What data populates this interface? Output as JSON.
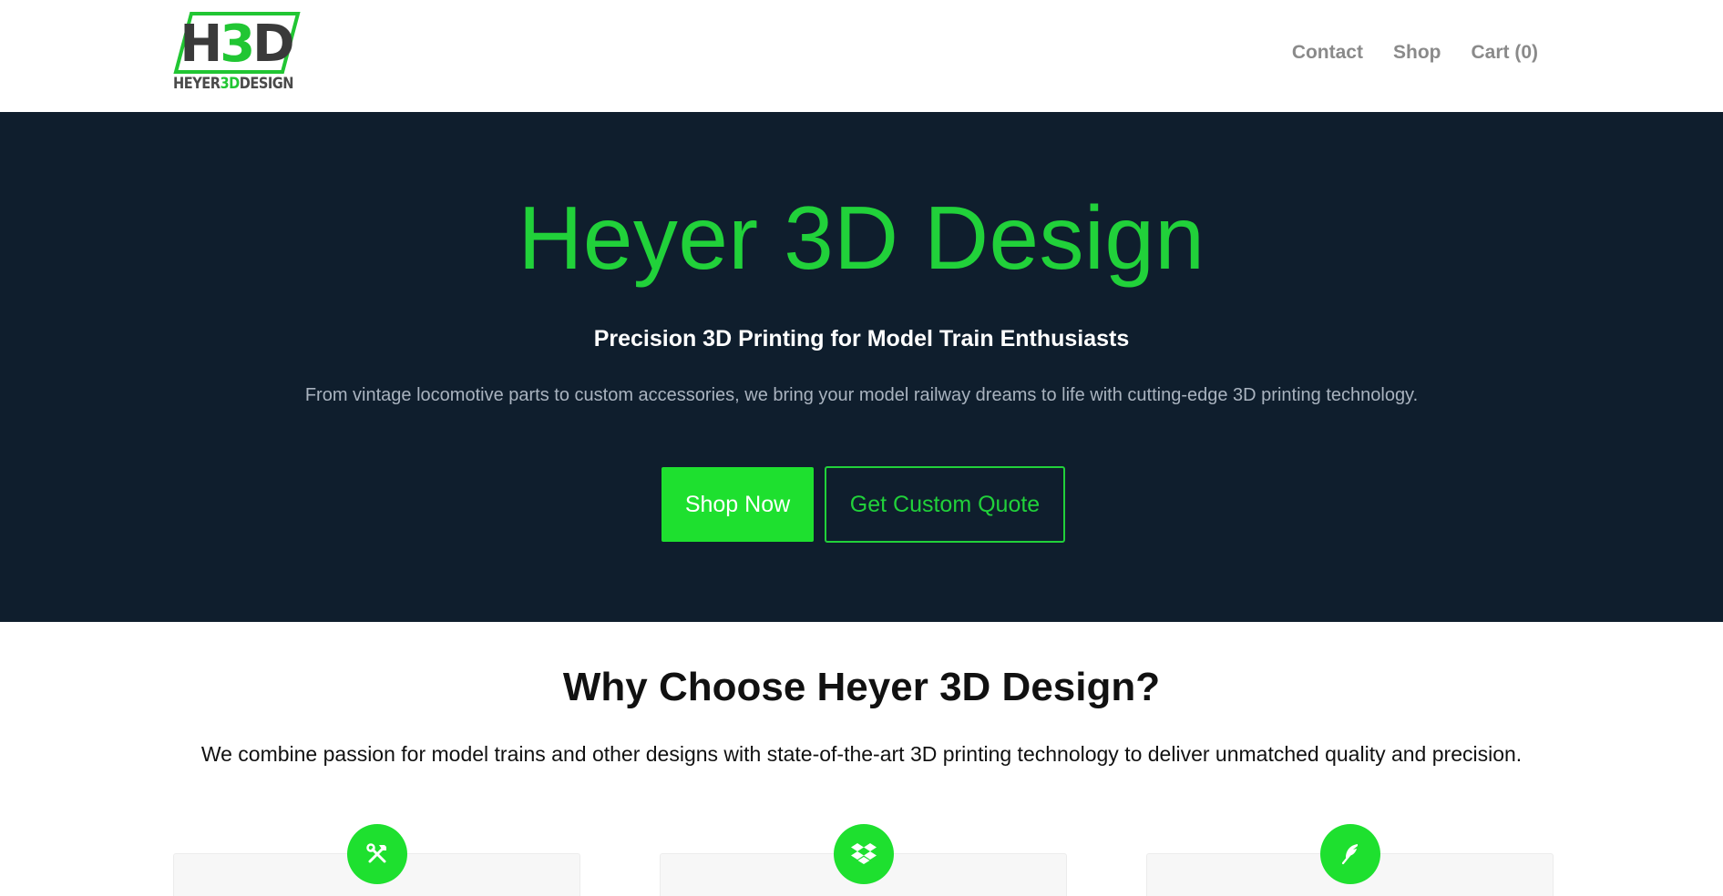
{
  "header": {
    "logo": {
      "monogram": "H3D",
      "wordmark_prefix": "HEYER",
      "wordmark_accent": "3D",
      "wordmark_suffix": "DESIGN"
    },
    "nav": [
      {
        "label": "Contact"
      },
      {
        "label": "Shop"
      },
      {
        "label": "Cart (0)"
      }
    ]
  },
  "hero": {
    "title": "Heyer 3D Design",
    "subtitle": "Precision 3D Printing for Model Train Enthusiasts",
    "description": "From vintage locomotive parts to custom accessories, we bring your model railway dreams to life with cutting-edge 3D printing technology.",
    "primary_button": "Shop Now",
    "secondary_button": "Get Custom Quote"
  },
  "features": {
    "title": "Why Choose Heyer 3D Design?",
    "description": "We combine passion for model trains and other designs with state-of-the-art 3D printing technology to deliver unmatched quality and precision.",
    "cards": [
      {
        "icon": "tools-icon"
      },
      {
        "icon": "dropbox-icon"
      },
      {
        "icon": "feather-icon"
      }
    ]
  },
  "colors": {
    "accent": "#1ee02f",
    "hero_background": "#0f1e2d",
    "nav_text": "#8a8a8a"
  }
}
